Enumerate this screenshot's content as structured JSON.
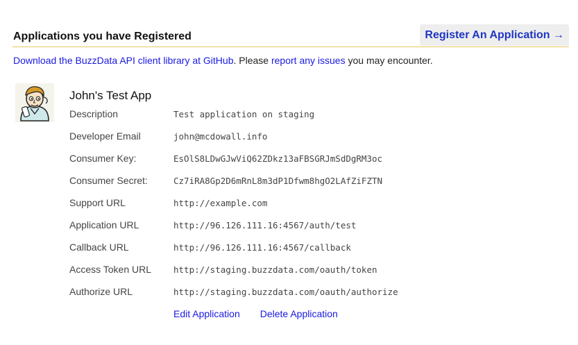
{
  "header": {
    "title": "Applications you have Registered",
    "register_label": "Register An Application →"
  },
  "intro": {
    "link1": "Download the BuzzData API client library at GitHub",
    "text1": ". Please ",
    "link2": "report any issues",
    "text2": " you may encounter."
  },
  "app": {
    "name": "John's Test App",
    "fields": [
      {
        "label": "Description",
        "value": "Test application on staging"
      },
      {
        "label": "Developer Email",
        "value": "john@mcdowall.info"
      },
      {
        "label": "Consumer Key:",
        "value": "EsOlS8LDwGJwViQ62ZDkz13aFBSGRJmSdDgRM3oc"
      },
      {
        "label": "Consumer Secret:",
        "value": "Cz7iRA8Gp2D6mRnL8m3dP1Dfwm8hgO2LAfZiFZTN"
      },
      {
        "label": "Support URL",
        "value": "http://example.com"
      },
      {
        "label": "Application URL",
        "value": "http://96.126.111.16:4567/auth/test"
      },
      {
        "label": "Callback URL",
        "value": "http://96.126.111.16:4567/callback"
      },
      {
        "label": "Access Token URL",
        "value": "http://staging.buzzdata.com/oauth/token"
      },
      {
        "label": "Authorize URL",
        "value": "http://staging.buzzdata.com/oauth/authorize"
      }
    ],
    "edit_label": "Edit Application",
    "delete_label": "Delete Application"
  },
  "colors": {
    "link": "#1a1adf",
    "register": "#1f36c4",
    "divider": "#e9c75a"
  },
  "icons": {
    "avatar": "cartoon-avatar-icon"
  }
}
